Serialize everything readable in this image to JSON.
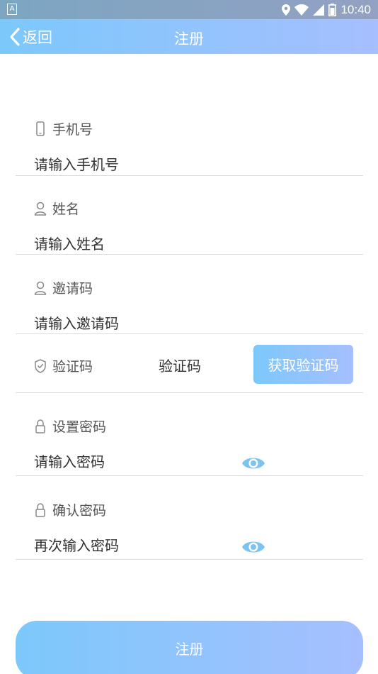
{
  "status_bar": {
    "time": "10:40",
    "left_badge": "A"
  },
  "nav": {
    "back_label": "返回",
    "title": "注册"
  },
  "form": {
    "phone": {
      "label": "手机号",
      "placeholder": "请输入手机号"
    },
    "name": {
      "label": "姓名",
      "placeholder": "请输入姓名"
    },
    "invite": {
      "label": "邀请码",
      "placeholder": "请输入邀请码"
    },
    "code": {
      "label": "验证码",
      "placeholder": "验证码",
      "button": "获取验证码"
    },
    "password": {
      "label": "设置密码",
      "placeholder": "请输入密码"
    },
    "confirm": {
      "label": "确认密码",
      "placeholder": "再次输入密码"
    }
  },
  "submit_label": "注册",
  "colors": {
    "gradient_start": "#7cc8fb",
    "gradient_end": "#a6bffe",
    "eye_icon": "#7cc3f0",
    "label_icon": "#888888"
  }
}
